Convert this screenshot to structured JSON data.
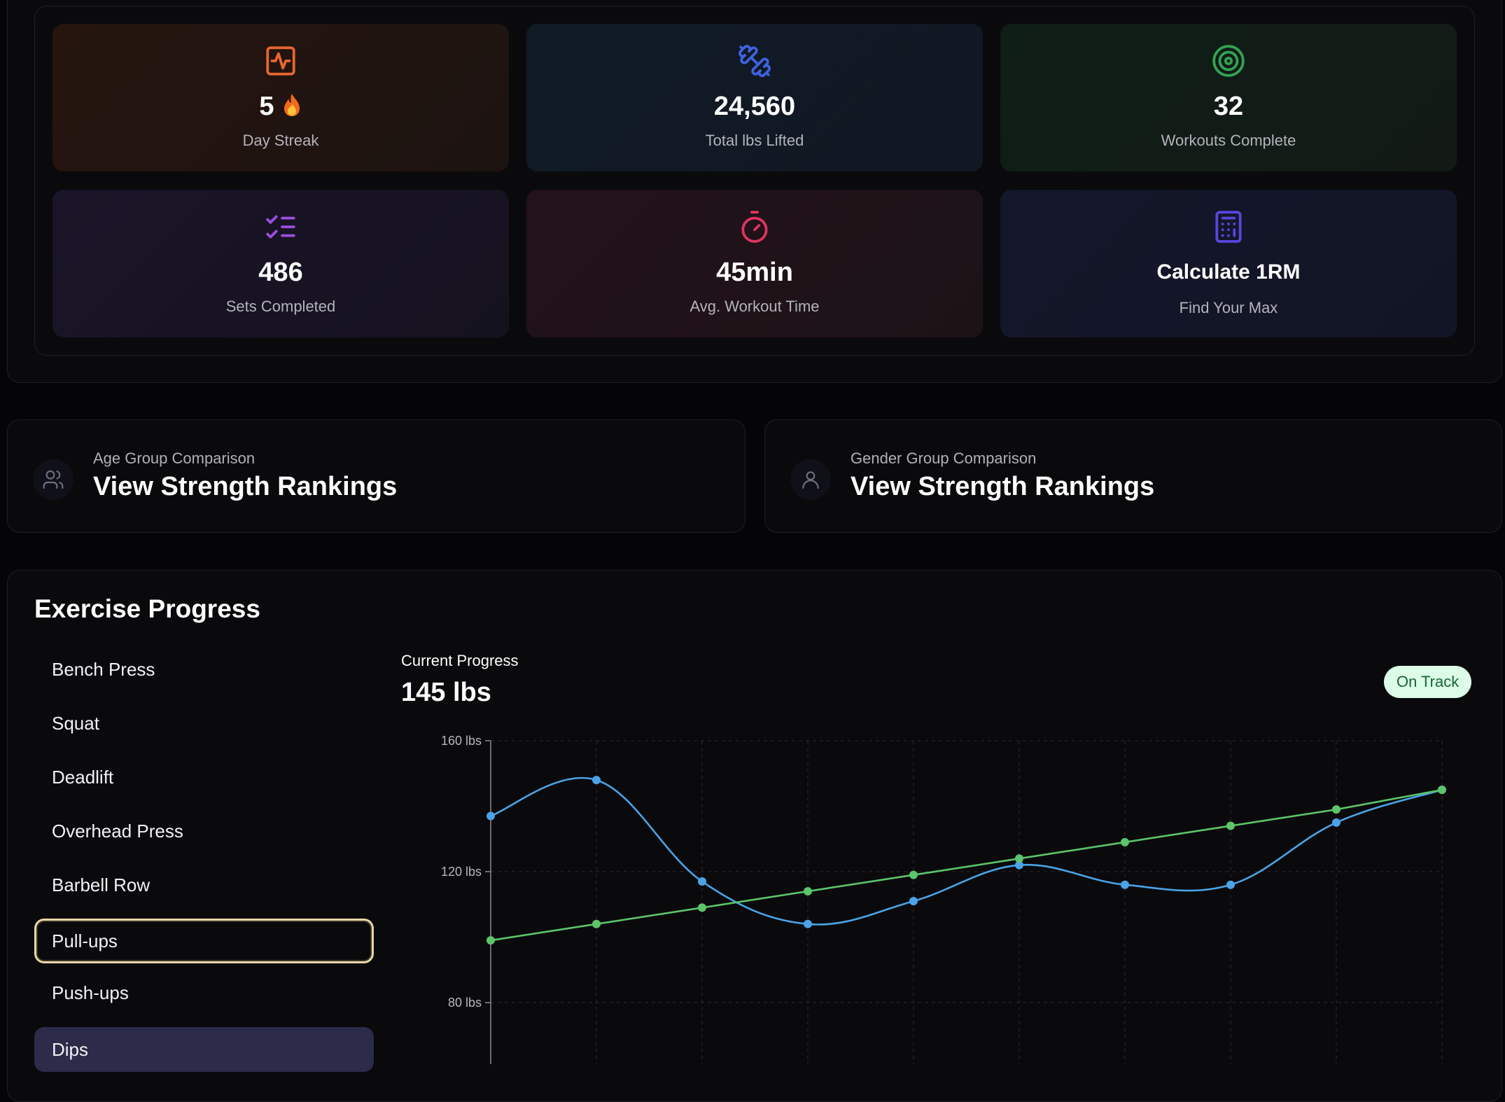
{
  "stats": {
    "streak": {
      "value": "5",
      "label": "Day Streak",
      "icon": "activity-icon",
      "color": "#e8662f"
    },
    "lifted": {
      "value": "24,560",
      "label": "Total lbs Lifted",
      "icon": "dumbbell-icon",
      "color": "#3f62e0"
    },
    "workouts": {
      "value": "32",
      "label": "Workouts Complete",
      "icon": "target-icon",
      "color": "#33a354"
    },
    "sets": {
      "value": "486",
      "label": "Sets Completed",
      "icon": "list-checks-icon",
      "color": "#9d4ee0"
    },
    "time": {
      "value": "45min",
      "label": "Avg. Workout Time",
      "icon": "timer-icon",
      "color": "#e0345f"
    },
    "calc": {
      "value": "Calculate 1RM",
      "label": "Find Your Max",
      "icon": "calculator-icon",
      "color": "#5b45e0"
    }
  },
  "comparisons": {
    "age": {
      "subtitle": "Age Group Comparison",
      "title": "View Strength Rankings",
      "icon": "users-icon"
    },
    "gender": {
      "subtitle": "Gender Group Comparison",
      "title": "View Strength Rankings",
      "icon": "user-icon"
    }
  },
  "progress": {
    "title": "Exercise Progress",
    "exercises": [
      "Bench Press",
      "Squat",
      "Deadlift",
      "Overhead Press",
      "Barbell Row",
      "Pull-ups",
      "Push-ups",
      "Dips"
    ],
    "focused_exercise": "Pull-ups",
    "selected_exercise": "Dips",
    "current_label": "Current Progress",
    "current_value": "145 lbs",
    "status": "On Track",
    "status_colors": {
      "bg": "#dcfce7",
      "text": "#166534"
    }
  },
  "chart_data": {
    "type": "line",
    "x": [
      1,
      2,
      3,
      4,
      5,
      6,
      7,
      8,
      9,
      10
    ],
    "ylim": [
      70,
      160
    ],
    "yticks": [
      80,
      120,
      160
    ],
    "ytick_labels": [
      "80 lbs",
      "120 lbs",
      "160 lbs"
    ],
    "grid": true,
    "series": [
      {
        "color": "#4aa3e8",
        "values": [
          137,
          148,
          117,
          104,
          111,
          122,
          116,
          116,
          135,
          145
        ]
      },
      {
        "color": "#5cc46a",
        "values": [
          99,
          104,
          109,
          114,
          119,
          124,
          129,
          134,
          139,
          145
        ]
      }
    ]
  }
}
